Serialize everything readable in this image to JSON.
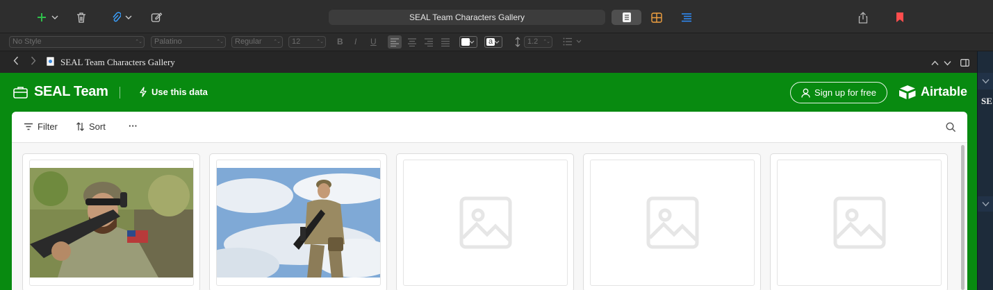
{
  "window": {
    "title": "SEAL Team Characters Gallery"
  },
  "toolbar": {
    "add_icon": "plus-icon",
    "trash_icon": "trash-icon",
    "attach_icon": "paperclip-icon",
    "compose_icon": "compose-icon",
    "share_icon": "share-icon",
    "bookmark_icon": "bookmark-icon",
    "colors": {
      "add": "#2fbf4a",
      "attach": "#3aa0ff",
      "grid": "#f0a040",
      "outline": "#2f8fff",
      "bookmark": "#ff4d4d"
    }
  },
  "formatbar": {
    "paragraph_style": "No Style",
    "font_family": "Palatino",
    "font_weight": "Regular",
    "font_size": "12",
    "bold": "B",
    "italic": "I",
    "underline": "U",
    "highlight_value": "a",
    "line_spacing": "1.2"
  },
  "document": {
    "title": "SEAL Team Characters Gallery"
  },
  "sidebar_peek": {
    "text": "SE"
  },
  "airtable": {
    "base_name": "SEAL Team",
    "use_data_label": "Use this data",
    "signup_label": "Sign up for free",
    "logo_text": "Airtable",
    "brand_color": "#088a10",
    "filter_label": "Filter",
    "sort_label": "Sort",
    "more_label": "···",
    "cards": [
      {
        "image": "soldier-closeup-photo"
      },
      {
        "image": "soldier-sky-photo"
      },
      {
        "image": "placeholder-image-icon"
      },
      {
        "image": "placeholder-image-icon"
      },
      {
        "image": "placeholder-image-icon"
      }
    ]
  }
}
